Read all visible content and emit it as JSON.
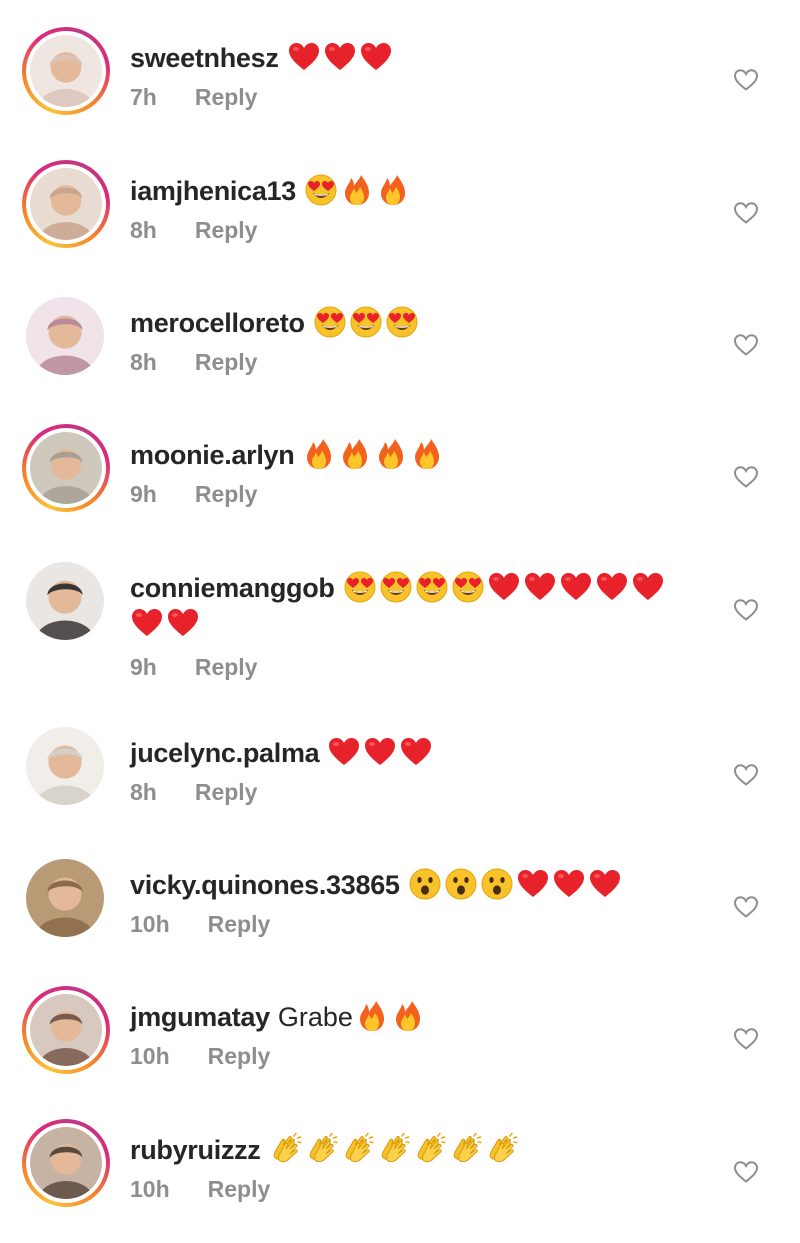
{
  "comments": [
    {
      "username": "sweetnhesz",
      "text": "",
      "emojis": [
        "heart",
        "heart",
        "heart"
      ],
      "emojis2": [],
      "time": "7h",
      "reply": "Reply",
      "story": true,
      "avatar_color": "#d9c3b8"
    },
    {
      "username": "iamjhenica13",
      "text": "",
      "emojis": [
        "heart-eyes",
        "fire",
        "fire"
      ],
      "emojis2": [],
      "time": "8h",
      "reply": "Reply",
      "story": true,
      "avatar_color": "#c9a58e"
    },
    {
      "username": "merocelloreto",
      "text": "",
      "emojis": [
        "heart-eyes",
        "heart-eyes",
        "heart-eyes"
      ],
      "emojis2": [],
      "time": "8h",
      "reply": "Reply",
      "story": false,
      "avatar_color": "#b98a9a"
    },
    {
      "username": "moonie.arlyn",
      "text": "",
      "emojis": [
        "fire",
        "fire",
        "fire",
        "fire"
      ],
      "emojis2": [],
      "time": "9h",
      "reply": "Reply",
      "story": true,
      "avatar_color": "#a7a195"
    },
    {
      "username": "conniemanggob",
      "text": "",
      "emojis": [
        "heart-eyes",
        "heart-eyes",
        "heart-eyes",
        "heart-eyes",
        "heart",
        "heart",
        "heart",
        "heart",
        "heart"
      ],
      "emojis2": [
        "heart",
        "heart"
      ],
      "time": "9h",
      "reply": "Reply",
      "story": false,
      "avatar_color": "#3b3434"
    },
    {
      "username": "jucelync.palma",
      "text": "",
      "emojis": [
        "heart",
        "heart",
        "heart"
      ],
      "emojis2": [],
      "time": "8h",
      "reply": "Reply",
      "story": false,
      "avatar_color": "#d4cfc8"
    },
    {
      "username": "vicky.quinones.33865",
      "text": "",
      "emojis": [
        "hushed",
        "hushed",
        "hushed",
        "heart",
        "heart",
        "heart"
      ],
      "emojis2": [],
      "time": "10h",
      "reply": "Reply",
      "story": false,
      "avatar_color": "#8a6a4a"
    },
    {
      "username": "jmgumatay",
      "text": "Grabe",
      "emojis": [
        "fire",
        "fire"
      ],
      "emojis2": [],
      "time": "10h",
      "reply": "Reply",
      "story": true,
      "avatar_color": "#7a5a4a"
    },
    {
      "username": "rubyruizzz",
      "text": "",
      "emojis": [
        "clap",
        "clap",
        "clap",
        "clap",
        "clap",
        "clap",
        "clap"
      ],
      "emojis2": [],
      "time": "10h",
      "reply": "Reply",
      "story": true,
      "avatar_color": "#5a4a3e"
    }
  ],
  "colors": {
    "username": "#262626",
    "meta": "#8e8e8e",
    "heart_red": "#e8222b",
    "like_outline": "#8e8e8e"
  },
  "icons": {
    "like": "heart-outline-icon",
    "heart": "red-heart-emoji",
    "heart-eyes": "heart-eyes-emoji",
    "fire": "fire-emoji",
    "hushed": "hushed-face-emoji",
    "clap": "clapping-hands-emoji"
  }
}
